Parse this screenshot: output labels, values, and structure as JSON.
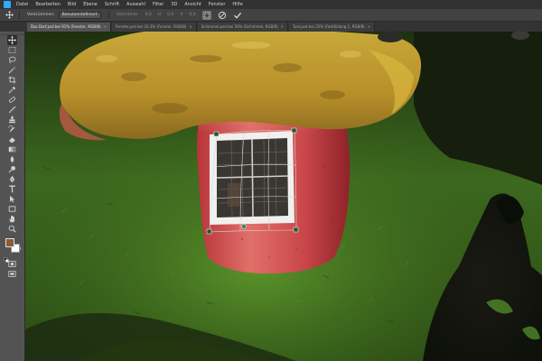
{
  "app": {
    "logo_label": "Ps"
  },
  "menu": [
    "Datei",
    "Bearbeiten",
    "Bild",
    "Ebene",
    "Schrift",
    "Auswahl",
    "Filter",
    "3D",
    "Ansicht",
    "Fenster",
    "Hilfe"
  ],
  "options_bar": {
    "tool_icon": "move-transform-icon",
    "mode_label": "Verkrümmen:",
    "mode_value": "Benutzerdefiniert",
    "field_labels": [
      "Verkrümm.",
      "H",
      "V"
    ],
    "field_values": [
      "0,0",
      "0,0",
      "0,0"
    ],
    "cancel_icon": "cancel-transform-icon",
    "commit_icon": "commit-transform-icon"
  },
  "tabs": [
    {
      "label": "Das Dorf.psd bei 91% (Fenster, RGB/8)",
      "active": true
    },
    {
      "label": "Fenster.psd bei 33,3% (Fenster, RGB/8)",
      "active": false
    },
    {
      "label": "Schimmel.psd bei 50% (Schimmel, RGB/8)",
      "active": false
    },
    {
      "label": "Tuer.psd bei 25% (Farbfüllung 1, RGB/8)",
      "active": false
    }
  ],
  "tools": [
    "move-icon",
    "marquee-icon",
    "lasso-icon",
    "magic-wand-icon",
    "crop-icon",
    "eyedropper-icon",
    "healing-brush-icon",
    "brush-icon",
    "clone-stamp-icon",
    "history-brush-icon",
    "eraser-icon",
    "gradient-icon",
    "blur-icon",
    "dodge-icon",
    "pen-icon",
    "type-icon",
    "path-selection-icon",
    "rectangle-icon",
    "hand-icon",
    "zoom-icon"
  ],
  "colors": {
    "foreground": "#8b5a36",
    "background": "#ffffff",
    "accent": "#31a8ff",
    "panel": "#535353",
    "menubar": "#323232"
  }
}
